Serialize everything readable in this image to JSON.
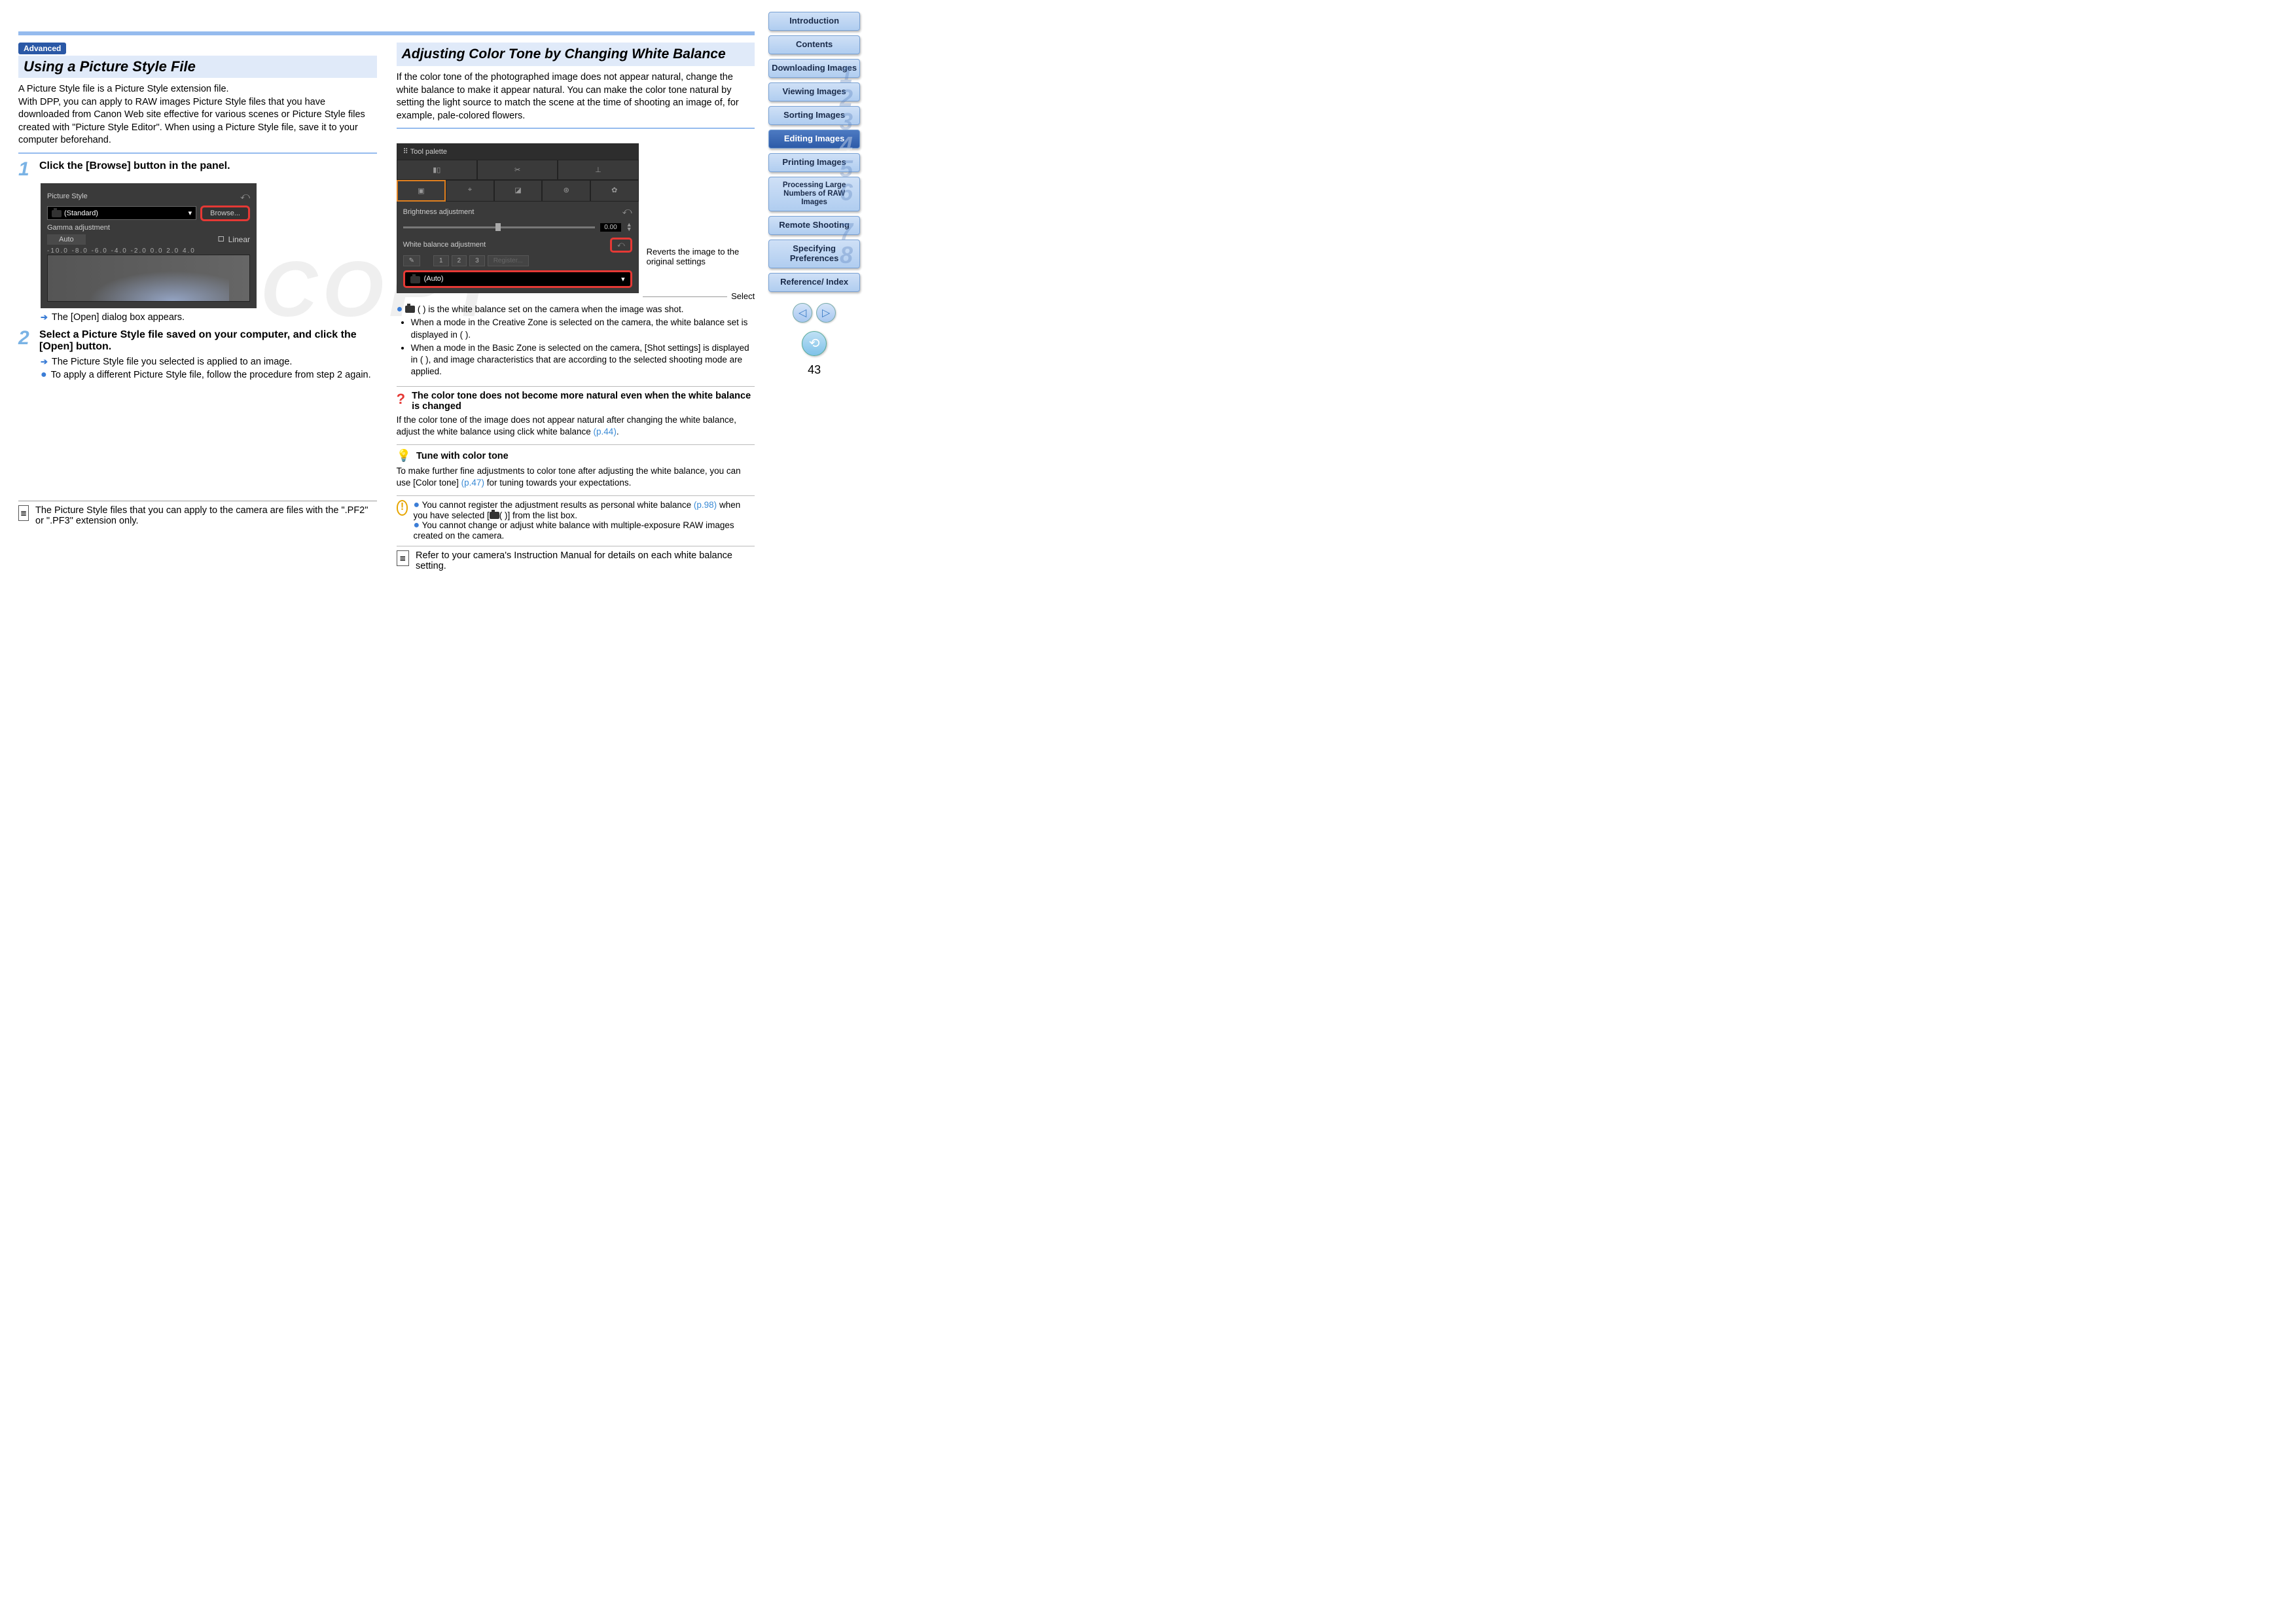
{
  "badge": "Advanced",
  "left": {
    "heading": "Using a Picture Style File",
    "intro": "A Picture Style file is a Picture Style extension file.\nWith DPP, you can apply to RAW images Picture Style files that you have downloaded from Canon Web site effective for various scenes or Picture Style files created with \"Picture Style Editor\". When using a Picture Style file, save it to your computer beforehand.",
    "step1_title": "Click the [Browse] button in the panel.",
    "shot1": {
      "picture_style": "Picture Style",
      "standard": "(Standard)",
      "browse": "Browse...",
      "gamma": "Gamma adjustment",
      "auto": "Auto",
      "linear": "Linear",
      "scale": "-10.0  -8.0   -6.0   -4.0   -2.0    0.0    2.0    4.0"
    },
    "step1_result": "The [Open] dialog box appears.",
    "step2_title": "Select a Picture Style file saved on your computer, and click the [Open] button.",
    "step2_result": "The Picture Style file you selected is applied to an image.",
    "step2_extra": "To apply a different Picture Style file, follow the procedure from step 2 again.",
    "footnote": "The Picture Style files that you can apply to the camera are files with the \".PF2\" or \".PF3\" extension only."
  },
  "right": {
    "heading": "Adjusting Color Tone by Changing White Balance",
    "intro": "If the color tone of the photographed image does not appear natural, change the white balance to make it appear natural. You can make the color tone natural by setting the light source to match the scene at the time of shooting an image of, for example, pale-colored flowers.",
    "shot2": {
      "tool_palette": "Tool palette",
      "brightness": "Brightness adjustment",
      "brightness_val": "0.00",
      "wb_adj": "White balance adjustment",
      "nums": [
        "1",
        "2",
        "3"
      ],
      "register": "Register...",
      "auto": "(Auto)",
      "callout_revert": "Reverts the image to the original settings",
      "callout_select": "Select"
    },
    "info1_lead": "( ) is the white balance set on the camera when the image was shot.",
    "info1_b1": "When a mode in the Creative Zone is selected on the camera, the white balance set is displayed in ( ).",
    "info1_b2": "When a mode in the Basic Zone is selected on the camera, [Shot settings] is displayed in ( ), and image characteristics that are according to the selected shooting mode are applied.",
    "q_title": "The color tone does not become more natural even when the white balance is changed",
    "q_body_a": "If the color tone of the image does not appear natural after changing the white balance, adjust the white balance using click white balance ",
    "q_link": "(p.44)",
    "q_body_b": ".",
    "hint_title": "Tune with color tone",
    "hint_body_a": "To make further fine adjustments to color tone after adjusting the white balance, you can use [Color tone] ",
    "hint_link": "(p.47)",
    "hint_body_b": " for tuning towards your expectations.",
    "warn1_a": "You cannot register the adjustment results as personal white balance ",
    "warn1_link": "(p.98)",
    "warn1_b": " when you have selected [",
    "warn1_c": "( )] from the list box.",
    "warn2": "You cannot change or adjust white balance with multiple-exposure RAW images created on the camera.",
    "footnote": "Refer to your camera's Instruction Manual for details on each white balance setting."
  },
  "sidebar": {
    "items": [
      {
        "label": "Introduction",
        "num": ""
      },
      {
        "label": "Contents",
        "num": ""
      },
      {
        "label": "Downloading Images",
        "num": "1"
      },
      {
        "label": "Viewing Images",
        "num": "2"
      },
      {
        "label": "Sorting Images",
        "num": "3"
      },
      {
        "label": "Editing Images",
        "num": "4",
        "active": true
      },
      {
        "label": "Printing Images",
        "num": "5"
      },
      {
        "label": "Processing Large Numbers of RAW Images",
        "num": "6"
      },
      {
        "label": "Remote Shooting",
        "num": "7"
      },
      {
        "label": "Specifying Preferences",
        "num": "8"
      },
      {
        "label": "Reference/ Index",
        "num": ""
      }
    ],
    "page_num": "43"
  },
  "watermark": "COPY"
}
